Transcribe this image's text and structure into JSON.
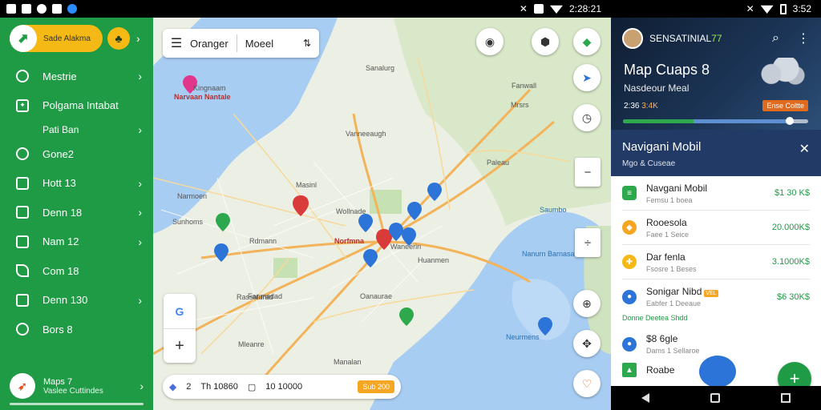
{
  "status_left": {
    "time": "2:28:21"
  },
  "status_right": {
    "time": "3:52"
  },
  "drawer": {
    "logo_text": "Sade Alakma",
    "items": [
      {
        "label": "Mestrie"
      },
      {
        "label": "Polgama Intabat"
      },
      {
        "label": "Pati Ban",
        "sub": true
      },
      {
        "label": "Gone2"
      },
      {
        "label": "Hott 13"
      },
      {
        "label": "Denn 18"
      },
      {
        "label": "Nam 12"
      },
      {
        "label": "Com 18"
      },
      {
        "label": "Denn 130"
      },
      {
        "label": "Bors 8"
      }
    ],
    "footer": {
      "title": "Maps 7",
      "subtitle": "Vaslee Cuttindes"
    }
  },
  "map": {
    "search_left": "Oranger",
    "search_right": "Moeel",
    "bottom": {
      "count": "2",
      "dist": "Th 10860",
      "dist2": "10 10000",
      "tag": "Sub 200"
    },
    "labels": [
      {
        "text": "Kingnaam",
        "cls": ""
      },
      {
        "text": "Narvaan Nantale",
        "cls": "red"
      },
      {
        "text": "Sanalurg",
        "cls": ""
      },
      {
        "text": "Vanneeaugh",
        "cls": ""
      },
      {
        "text": "Fanwall",
        "cls": ""
      },
      {
        "text": "Narmoen",
        "cls": ""
      },
      {
        "text": "Masinl",
        "cls": ""
      },
      {
        "text": "Norfmna",
        "cls": "red"
      },
      {
        "text": "Waneerin",
        "cls": ""
      },
      {
        "text": "Rdmann",
        "cls": ""
      },
      {
        "text": "Fanmadad",
        "cls": ""
      },
      {
        "text": "Oanaurae",
        "cls": ""
      },
      {
        "text": "Saumbo",
        "cls": "blue"
      },
      {
        "text": "Nanurn Barnasa",
        "cls": "blue"
      },
      {
        "text": "Huanmen",
        "cls": ""
      },
      {
        "text": "Wollnade",
        "cls": ""
      },
      {
        "text": "Sunhoms",
        "cls": ""
      },
      {
        "text": "Mleanre",
        "cls": ""
      },
      {
        "text": "Paleau",
        "cls": ""
      },
      {
        "text": "Manalan",
        "cls": ""
      },
      {
        "text": "Neurmens",
        "cls": "blue"
      },
      {
        "text": "Rassalurad",
        "cls": ""
      },
      {
        "text": "Mrsrs",
        "cls": ""
      }
    ]
  },
  "panel": {
    "user": "SENSATINIAL",
    "user_hl": "77",
    "hero_title": "Map Cuaps 8",
    "hero_sub": "Nasdeour Meal",
    "hero_meta": "2:36",
    "hero_meta_hl": "3:4K",
    "hero_badge": "Ense Coltte",
    "card_title": "Navigani Mobil",
    "card_sub": "Mgo & Cuseae",
    "rows": [
      {
        "title": "Navgani Mobil",
        "sub": "Femsu 1 boea",
        "value": "$1 30 K$",
        "color": "#2ea84d"
      },
      {
        "title": "Rooesola",
        "sub": "Faee 1 Seice",
        "value": "20.000K$",
        "color": "#f5a623"
      },
      {
        "title": "Dar fenla",
        "sub": "Fsosre 1 Beses",
        "value": "3.1000K$",
        "color": "#f5b916"
      },
      {
        "title": "Sonigar Nibd",
        "sub": "Eabfer 1 Deeaue",
        "value": "$6 30K$",
        "color": "#2d74d8",
        "badge": "VEL"
      }
    ],
    "note": "Donne Deetea Shdd",
    "row5": {
      "title": "$8 6gle",
      "sub": "Dams 1 Sellaroe"
    },
    "row6": {
      "title": "Roabe"
    },
    "progress_left": 0.38,
    "progress_knob": 0.9
  }
}
